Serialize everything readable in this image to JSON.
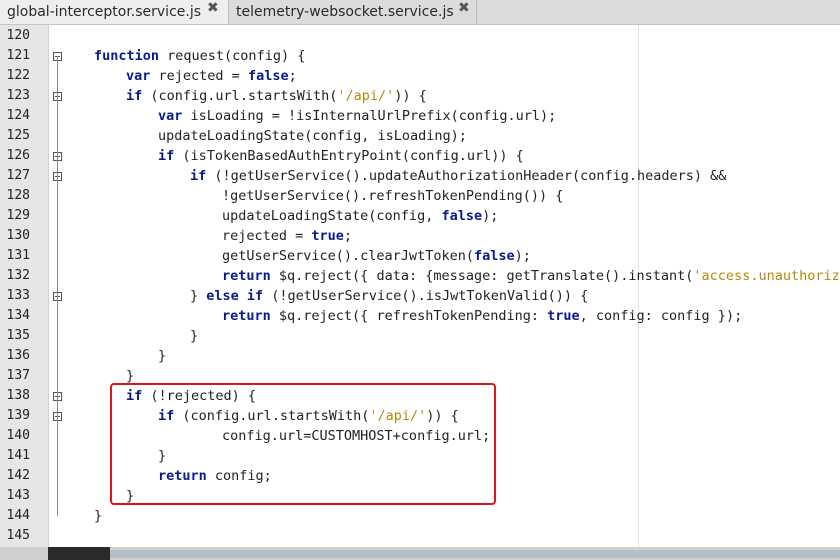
{
  "tabs": [
    {
      "label": "global-interceptor.service.js",
      "close": "✖"
    },
    {
      "label": "telemetry-websocket.service.js",
      "close": "✖"
    }
  ],
  "lines": [
    {
      "n": "120",
      "tokens": []
    },
    {
      "n": "121",
      "fold": true,
      "indent": 0,
      "tokens": [
        [
          "kw",
          "function"
        ],
        [
          "p",
          " request(config) {"
        ]
      ]
    },
    {
      "n": "122",
      "indent": 1,
      "tokens": [
        [
          "kw",
          "var"
        ],
        [
          "p",
          " rejected = "
        ],
        [
          "kw",
          "false"
        ],
        [
          "p",
          ";"
        ]
      ]
    },
    {
      "n": "123",
      "fold": true,
      "indent": 1,
      "tokens": [
        [
          "kw",
          "if"
        ],
        [
          "p",
          " (config.url.startsWith("
        ],
        [
          "str",
          "'/api/'"
        ],
        [
          "p",
          ")) {"
        ]
      ]
    },
    {
      "n": "124",
      "indent": 2,
      "tokens": [
        [
          "kw",
          "var"
        ],
        [
          "p",
          " isLoading = !isInternalUrlPrefix(config.url);"
        ]
      ]
    },
    {
      "n": "125",
      "indent": 2,
      "tokens": [
        [
          "p",
          "updateLoadingState(config, isLoading);"
        ]
      ]
    },
    {
      "n": "126",
      "fold": true,
      "indent": 2,
      "tokens": [
        [
          "kw",
          "if"
        ],
        [
          "p",
          " (isTokenBasedAuthEntryPoint(config.url)) {"
        ]
      ]
    },
    {
      "n": "127",
      "fold": true,
      "indent": 3,
      "tokens": [
        [
          "kw",
          "if"
        ],
        [
          "p",
          " (!getUserService().updateAuthorizationHeader(config.headers) &&"
        ]
      ]
    },
    {
      "n": "128",
      "indent": 4,
      "tokens": [
        [
          "p",
          "!getUserService().refreshTokenPending()) {"
        ]
      ]
    },
    {
      "n": "129",
      "indent": 4,
      "tokens": [
        [
          "p",
          "updateLoadingState(config, "
        ],
        [
          "kw",
          "false"
        ],
        [
          "p",
          ");"
        ]
      ]
    },
    {
      "n": "130",
      "indent": 4,
      "tokens": [
        [
          "p",
          "rejected = "
        ],
        [
          "kw",
          "true"
        ],
        [
          "p",
          ";"
        ]
      ]
    },
    {
      "n": "131",
      "indent": 4,
      "tokens": [
        [
          "p",
          "getUserService().clearJwtToken("
        ],
        [
          "kw",
          "false"
        ],
        [
          "p",
          ");"
        ]
      ]
    },
    {
      "n": "132",
      "indent": 4,
      "tokens": [
        [
          "kw",
          "return"
        ],
        [
          "p",
          " $q.reject({ data: {message: getTranslate().instant("
        ],
        [
          "str",
          "'access.unauthorized'"
        ]
      ]
    },
    {
      "n": "133",
      "fold": true,
      "indent": 3,
      "tokens": [
        [
          "p",
          "} "
        ],
        [
          "kw",
          "else if"
        ],
        [
          "p",
          " (!getUserService().isJwtTokenValid()) {"
        ]
      ]
    },
    {
      "n": "134",
      "indent": 4,
      "tokens": [
        [
          "kw",
          "return"
        ],
        [
          "p",
          " $q.reject({ refreshTokenPending: "
        ],
        [
          "kw",
          "true"
        ],
        [
          "p",
          ", config: config });"
        ]
      ]
    },
    {
      "n": "135",
      "indent": 3,
      "tokens": [
        [
          "p",
          "}"
        ]
      ]
    },
    {
      "n": "136",
      "indent": 2,
      "tokens": [
        [
          "p",
          "}"
        ]
      ]
    },
    {
      "n": "137",
      "indent": 1,
      "tokens": [
        [
          "p",
          "}"
        ]
      ]
    },
    {
      "n": "138",
      "fold": true,
      "indent": 1,
      "tokens": [
        [
          "kw",
          "if"
        ],
        [
          "p",
          " (!rejected) {"
        ]
      ]
    },
    {
      "n": "139",
      "fold": true,
      "indent": 2,
      "tokens": [
        [
          "kw",
          "if"
        ],
        [
          "p",
          " (config.url.startsWith("
        ],
        [
          "str",
          "'/api/'"
        ],
        [
          "p",
          ")) {"
        ]
      ]
    },
    {
      "n": "140",
      "indent": 4,
      "tokens": [
        [
          "p",
          "config.url=CUSTOMHOST+config.url;"
        ]
      ]
    },
    {
      "n": "141",
      "indent": 2,
      "tokens": [
        [
          "p",
          "}"
        ]
      ]
    },
    {
      "n": "142",
      "indent": 2,
      "tokens": [
        [
          "kw",
          "return"
        ],
        [
          "p",
          " config;"
        ]
      ]
    },
    {
      "n": "143",
      "indent": 1,
      "tokens": [
        [
          "p",
          "}"
        ]
      ]
    },
    {
      "n": "144",
      "indent": 0,
      "tokens": [
        [
          "p",
          "}"
        ]
      ]
    },
    {
      "n": "145",
      "tokens": []
    }
  ],
  "colors": {
    "keyword": "#0a1a90",
    "string": "#b8860b",
    "highlight_box": "#e0151c"
  }
}
